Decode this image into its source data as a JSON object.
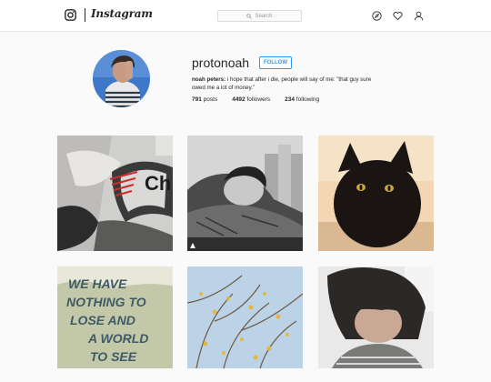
{
  "header": {
    "wordmark": "Instagram",
    "search_placeholder": "Search",
    "icons": [
      "instagram-camera-icon",
      "compass-icon",
      "heart-icon",
      "person-icon"
    ]
  },
  "profile": {
    "username": "protonoah",
    "follow_label": "FOLLOW",
    "bio_name": "noah peters:",
    "bio_text": " i hope that after i die, people will say of me: \"that guy sure owed me a lot of money.\"",
    "posts_count": "791",
    "posts_label": " posts",
    "followers_count": "4492",
    "followers_label": " followers",
    "following_count": "234",
    "following_label": " following"
  },
  "posts": {
    "quote_line1": "WE HAVE",
    "quote_line2": "NOTHING TO",
    "quote_line3": "LOSE AND",
    "quote_line4": "A WORLD",
    "quote_line5": "TO SEE",
    "graffiti_text": "Ch"
  },
  "colors": {
    "accent": "#3897f0",
    "border": "#dbdbdb",
    "text": "#262626"
  }
}
